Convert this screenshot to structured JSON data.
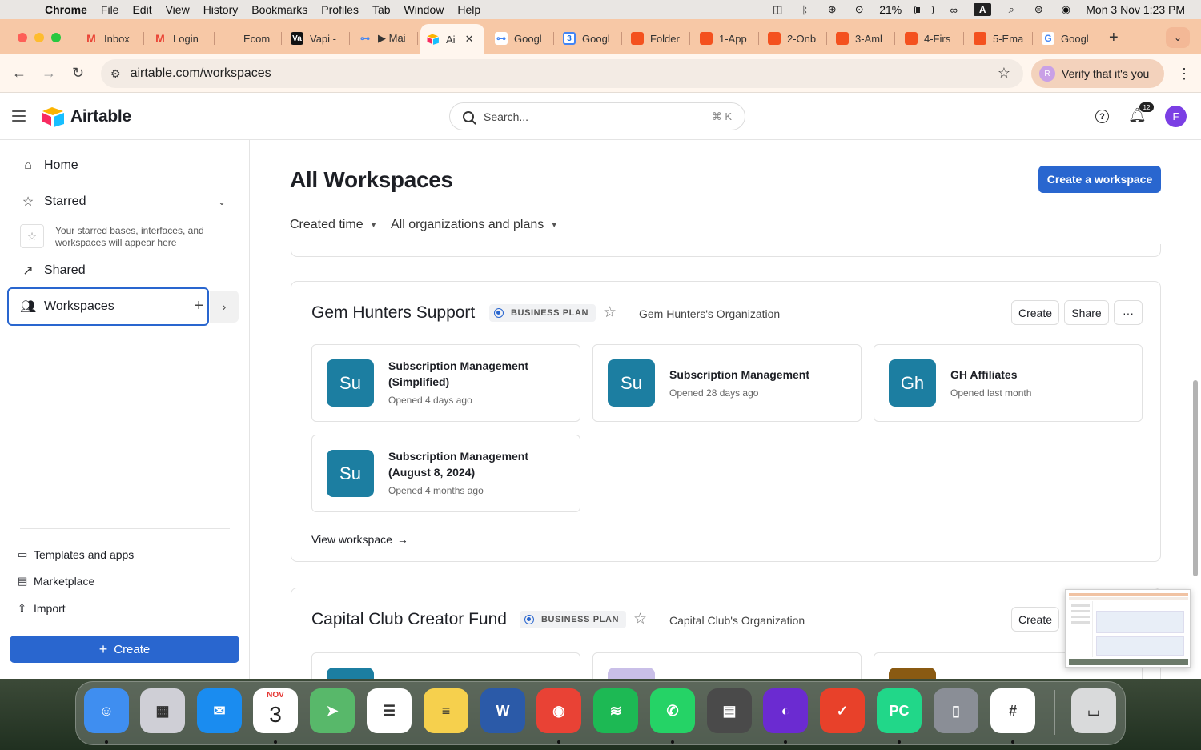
{
  "menubar": {
    "app": "Chrome",
    "items": [
      "File",
      "Edit",
      "View",
      "History",
      "Bookmarks",
      "Profiles",
      "Tab",
      "Window",
      "Help"
    ],
    "battery": "21%",
    "input_indicator": "A",
    "datetime": "Mon 3 Nov  1:23 PM"
  },
  "tabs": [
    {
      "label": "Inbox",
      "icon": "gmail-icon",
      "color": "#ea4335",
      "glyph": "M"
    },
    {
      "label": "Login",
      "icon": "gmail-icon",
      "color": "#ea4335",
      "glyph": "M"
    },
    {
      "label": "Ecom",
      "icon": "blank-page-icon",
      "color": "#f7c8a6",
      "glyph": ""
    },
    {
      "label": "Vapi -",
      "icon": "vapi-icon",
      "color": "#111111",
      "glyph": "Va"
    },
    {
      "label": "▶ Mai",
      "icon": "make-icon",
      "color": "#f7c8a6",
      "glyph": "⊶"
    },
    {
      "label": "Ai",
      "icon": "airtable-icon",
      "color": "#fff6ee",
      "glyph": "",
      "active": true
    },
    {
      "label": "Googl",
      "icon": "google-icon",
      "color": "#ffffff",
      "glyph": "⊶"
    },
    {
      "label": "Googl",
      "icon": "google-calendar-icon",
      "color": "#4285f4",
      "glyph": "3"
    },
    {
      "label": "Folder",
      "icon": "folder-icon",
      "color": "#f4511e",
      "glyph": ""
    },
    {
      "label": "1-App",
      "icon": "doc-icon",
      "color": "#f4511e",
      "glyph": ""
    },
    {
      "label": "2-Onb",
      "icon": "doc-icon",
      "color": "#f4511e",
      "glyph": ""
    },
    {
      "label": "3-Aml",
      "icon": "doc-icon",
      "color": "#f4511e",
      "glyph": ""
    },
    {
      "label": "4-Firs",
      "icon": "doc-icon",
      "color": "#f4511e",
      "glyph": ""
    },
    {
      "label": "5-Ema",
      "icon": "doc-icon",
      "color": "#f4511e",
      "glyph": ""
    },
    {
      "label": "Googl",
      "icon": "google-icon",
      "color": "#ffffff",
      "glyph": "G"
    }
  ],
  "address": {
    "url": "airtable.com/workspaces",
    "verify_label": "Verify that it's you",
    "verify_initial": "R"
  },
  "app": {
    "logo_text": "Airtable",
    "search_placeholder": "Search...",
    "search_shortcut": "⌘ K",
    "notification_count": "12",
    "avatar_initial": "F"
  },
  "sidebar": {
    "home": "Home",
    "starred": "Starred",
    "starred_empty": "Your starred bases, interfaces, and workspaces will appear here",
    "shared": "Shared",
    "workspaces": "Workspaces",
    "links": [
      "Templates and apps",
      "Marketplace",
      "Import"
    ],
    "create": "Create"
  },
  "main": {
    "title": "All Workspaces",
    "create_workspace": "Create a workspace",
    "filter_sort": "Created time",
    "filter_orgs": "All organizations and plans",
    "workspaces": [
      {
        "name": "Gem Hunters Support",
        "plan": "BUSINESS PLAN",
        "org": "Gem Hunters's Organization",
        "actions": {
          "create": "Create",
          "share": "Share",
          "more": "···"
        },
        "bases": [
          {
            "initials": "Su",
            "name": "Subscription Management (Simplified)",
            "opened": "Opened 4 days ago"
          },
          {
            "initials": "Su",
            "name": "Subscription Management",
            "opened": "Opened 28 days ago"
          },
          {
            "initials": "Gh",
            "name": "GH Affiliates",
            "opened": "Opened last month"
          },
          {
            "initials": "Su",
            "name": "Subscription Management (August 8, 2024)",
            "opened": "Opened 4 months ago"
          }
        ],
        "view_label": "View workspace"
      },
      {
        "name": "Capital Club Creator Fund",
        "plan": "BUSINESS PLAN",
        "org": "Capital Club's Organization",
        "actions": {
          "create": "Create"
        }
      }
    ]
  },
  "colors": {
    "accent": "#2966cf",
    "base_tile": "#1c7ea1",
    "tab_strip": "#f7c8a6"
  },
  "dock": [
    {
      "name": "finder-icon",
      "color": "#3f8ef0",
      "glyph": "☺"
    },
    {
      "name": "launchpad-icon",
      "color": "#cfcfd6",
      "glyph": "▦"
    },
    {
      "name": "mail-icon",
      "color": "#1a8cf0",
      "glyph": "✉"
    },
    {
      "name": "calendar-icon",
      "color": "#ffffff",
      "glyph": "3",
      "month": "NOV"
    },
    {
      "name": "maps-icon",
      "color": "#58b86a",
      "glyph": "➤"
    },
    {
      "name": "reminders-icon",
      "color": "#ffffff",
      "glyph": "☰"
    },
    {
      "name": "notes-icon",
      "color": "#f6d04d",
      "glyph": "≡"
    },
    {
      "name": "word-icon",
      "color": "#2b5aa8",
      "glyph": "W"
    },
    {
      "name": "chrome-icon",
      "color": "#e94235",
      "glyph": "◉"
    },
    {
      "name": "spotify-icon",
      "color": "#1db954",
      "glyph": "≋"
    },
    {
      "name": "whatsapp-icon",
      "color": "#25d366",
      "glyph": "✆"
    },
    {
      "name": "calculator-icon",
      "color": "#4a4a4a",
      "glyph": "▤"
    },
    {
      "name": "firefox-icon",
      "color": "#6b2bd1",
      "glyph": "◐"
    },
    {
      "name": "tasks-icon",
      "color": "#e8412a",
      "glyph": "✓"
    },
    {
      "name": "pycharm-icon",
      "color": "#21d789",
      "glyph": "PC"
    },
    {
      "name": "iphone-mirroring-icon",
      "color": "#8a8e96",
      "glyph": "▯"
    },
    {
      "name": "slack-icon",
      "color": "#ffffff",
      "glyph": "#"
    },
    {
      "name": "trash-icon",
      "color": "#d9dadb",
      "glyph": "⌴"
    }
  ]
}
